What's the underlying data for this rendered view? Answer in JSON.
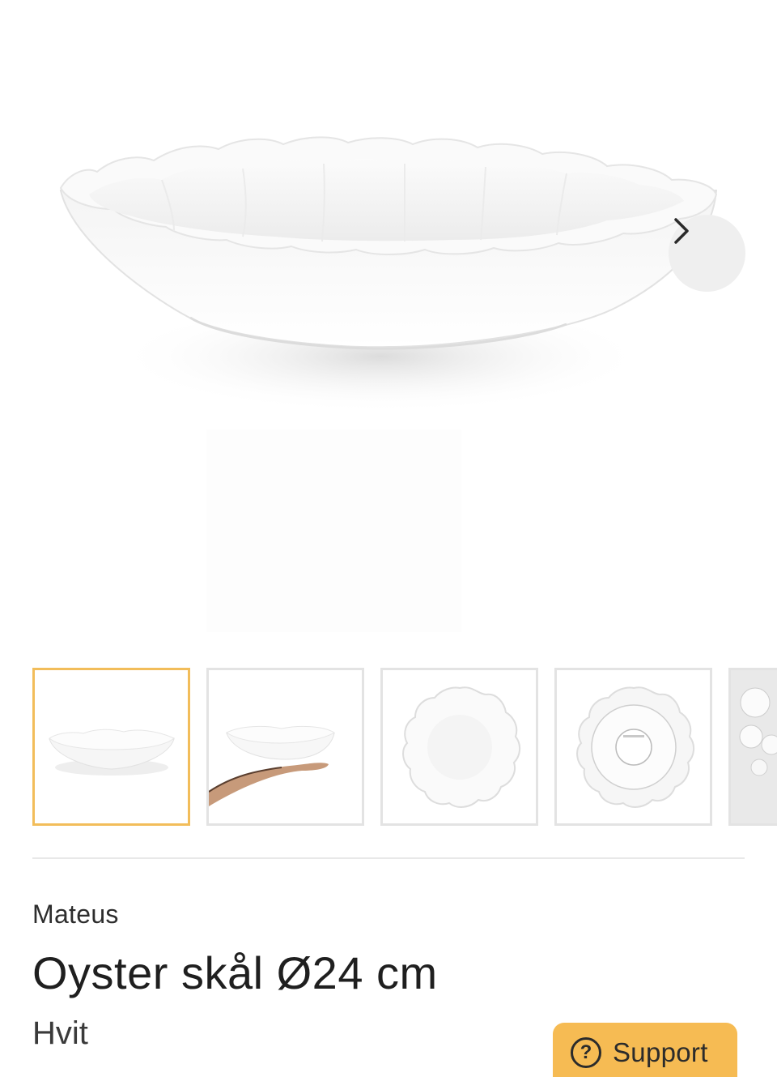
{
  "gallery": {
    "main_image": "white scalloped oyster bowl, side view",
    "next_icon": "chevron-right-icon",
    "thumbnails": [
      {
        "label": "bowl side view",
        "active": true
      },
      {
        "label": "bowl on hand",
        "active": false
      },
      {
        "label": "bowl top view",
        "active": false
      },
      {
        "label": "bowl bottom view",
        "active": false
      },
      {
        "label": "table setting",
        "active": false
      }
    ]
  },
  "product": {
    "brand": "Mateus",
    "title": "Oyster skål Ø24 cm",
    "color": "Hvit"
  },
  "support": {
    "label": "Support",
    "icon": "question-circle-icon",
    "color": "#f6bb53"
  },
  "colors": {
    "accent": "#f2bd5a",
    "thumb_border": "#e3e3e3"
  }
}
